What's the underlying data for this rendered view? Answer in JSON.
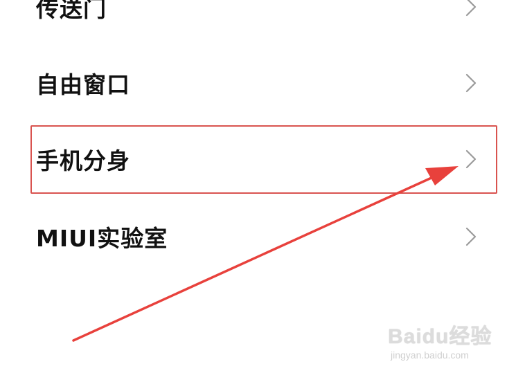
{
  "settings_list": {
    "items": [
      {
        "label": "传送门"
      },
      {
        "label": "自由窗口"
      },
      {
        "label": "手机分身"
      },
      {
        "label": "MIUI实验室"
      }
    ]
  },
  "annotation": {
    "highlight_color": "#d9534f",
    "arrow_color": "#e8413c"
  },
  "watermark": {
    "logo": "Baidu经验",
    "url": "jingyan.baidu.com"
  }
}
